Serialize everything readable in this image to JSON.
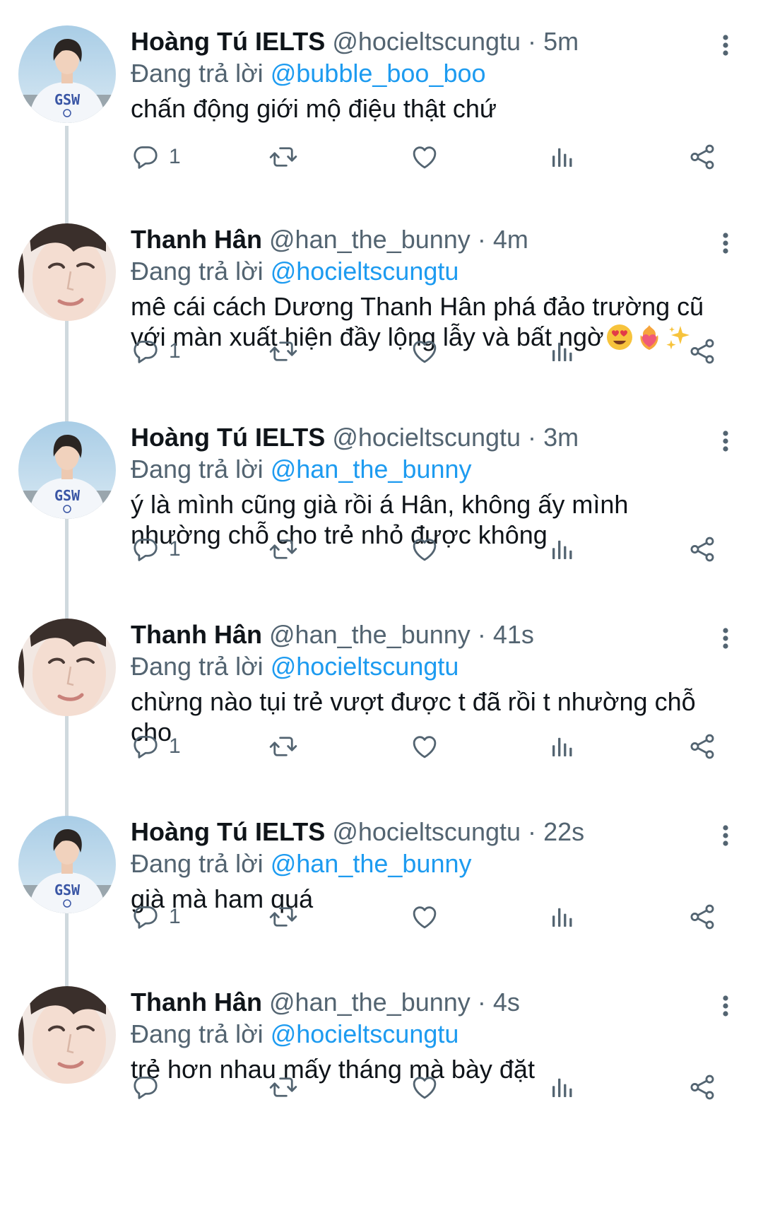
{
  "colors": {
    "text": "#0f1419",
    "secondary": "#536471",
    "accent": "#1d9bf0",
    "thread_line": "#cfd9de"
  },
  "tweets": [
    {
      "name": "Hoàng Tú IELTS",
      "handle": "@hocieltscungtu",
      "separator": "·",
      "time": "5m",
      "reply_prefix": "Đang trả lời",
      "reply_to": "@bubble_boo_boo",
      "text": "chấn động giới mộ điệu thật chứ",
      "reply_count": "1",
      "avatar": "hoang-tu-avatar"
    },
    {
      "name": "Thanh Hân",
      "handle": "@han_the_bunny",
      "separator": "·",
      "time": "4m",
      "reply_prefix": "Đang trả lời",
      "reply_to": "@hocieltscungtu",
      "text": "mê cái cách Dương Thanh Hân phá đảo trường cũ với màn xuất hiện đầy lộng lẫy và bất ngờ",
      "emojis": [
        "heart-eyes-emoji",
        "heart-on-fire-emoji",
        "sparkles-emoji"
      ],
      "reply_count": "1",
      "avatar": "thanh-han-avatar"
    },
    {
      "name": "Hoàng Tú IELTS",
      "handle": "@hocieltscungtu",
      "separator": "·",
      "time": "3m",
      "reply_prefix": "Đang trả lời",
      "reply_to": "@han_the_bunny",
      "text": "ý là mình cũng già rồi á Hân, không ấy mình nhường chỗ cho trẻ nhỏ được không",
      "reply_count": "1",
      "avatar": "hoang-tu-avatar"
    },
    {
      "name": "Thanh Hân",
      "handle": "@han_the_bunny",
      "separator": "·",
      "time": "41s",
      "reply_prefix": "Đang trả lời",
      "reply_to": "@hocieltscungtu",
      "text": "chừng nào tụi trẻ vượt được t đã rồi t nhường chỗ cho",
      "reply_count": "1",
      "avatar": "thanh-han-avatar"
    },
    {
      "name": "Hoàng Tú IELTS",
      "handle": "@hocieltscungtu",
      "separator": "·",
      "time": "22s",
      "reply_prefix": "Đang trả lời",
      "reply_to": "@han_the_bunny",
      "text": "già mà ham quá",
      "reply_count": "1",
      "avatar": "hoang-tu-avatar"
    },
    {
      "name": "Thanh Hân",
      "handle": "@han_the_bunny",
      "separator": "·",
      "time": "4s",
      "reply_prefix": "Đang trả lời",
      "reply_to": "@hocieltscungtu",
      "text": "trẻ hơn nhau mấy tháng mà bày đặt",
      "reply_count": "",
      "avatar": "thanh-han-avatar"
    }
  ],
  "icons": {
    "reply": "reply-icon",
    "retweet": "retweet-icon",
    "like": "heart-icon",
    "views": "views-icon",
    "share": "share-icon",
    "more": "more-icon"
  }
}
